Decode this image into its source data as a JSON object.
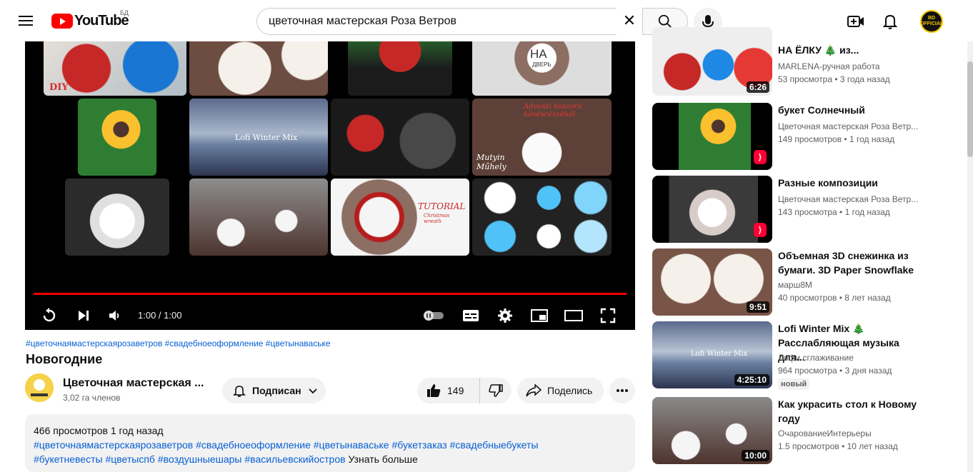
{
  "header": {
    "logo_text": "YouTube",
    "country_code": "БД",
    "search_value": "цветочная мастерская Роза Ветров",
    "avatar_text": "BD OFFICIAL"
  },
  "player": {
    "time": "1:00 / 1:00",
    "progress": 1.0,
    "grid_labels": {
      "tile_diy": "DIY",
      "tile_na": "НА",
      "tile_na_sub": "ДВЕРЬ",
      "tile_lofi": "Lofi Winter Mix",
      "tile_advent": "Adventi koszorú kávéscészéből",
      "tile_mutyi": "Mutyin Műhely",
      "tile_tutorial": "TUTORIAL",
      "tile_tutorial_sub": "Christmas wreath"
    }
  },
  "video": {
    "tags": "#цветочнаямастерскаярозаветров #свадебноеоформление #цветынаваське",
    "title": "Новогодние",
    "channel": "Цветочная мастерская ...",
    "subscribers": "3,02 га членов",
    "subscribe_label": "Подписан",
    "likes": "149",
    "share_label": "Поделись"
  },
  "description": {
    "stats": "466 просмотров 1 год назад",
    "line2": "#цветочнаямастерскаярозаветров #свадебноеоформление #цветынаваське #букетзаказ #свадебныебукеты",
    "line3_tags": "#букетневесты #цветыспб #воздушныешары #васильевскийостров",
    "more": "Узнать больше"
  },
  "recommendations": [
    {
      "title": "НА ЁЛКУ 🎄 из...",
      "channel": "MARLENA-ручная работа",
      "meta": "53 просмотра • 3 года назад",
      "duration": "6:26",
      "short": false
    },
    {
      "title": "букет Солнечный",
      "channel": "Цветочная мастерская Роза Ветр...",
      "meta": "149 просмотров • 1 год назад",
      "duration": "",
      "short": true
    },
    {
      "title": "Разные композиции",
      "channel": "Цветочная мастерская Роза Ветр...",
      "meta": "143 просмотра • 1 год назад",
      "duration": "",
      "short": true
    },
    {
      "title": "Объемная 3D снежинка из бумаги. 3D Paper Snowflake",
      "channel": "марш8М",
      "meta": "40 просмотров • 8 лет назад",
      "duration": "9:51",
      "short": false
    },
    {
      "title": "Lofi Winter Mix 🎄 Расслабляющая музыка для...",
      "channel": "Лофи сглаживание",
      "meta": "964 просмотра • 3 дня назад",
      "duration": "4:25:10",
      "short": false,
      "badge": "новый"
    },
    {
      "title": "Как украсить стол к Новому году",
      "channel": "ОчарованиеИнтерьеры",
      "meta": "1.5 просмотров • 10 лет назад",
      "duration": "10:00",
      "short": false
    }
  ],
  "colors": {
    "accent_red": "#ff0000",
    "link_blue": "#065fd4",
    "progress_red": "#e00000"
  }
}
